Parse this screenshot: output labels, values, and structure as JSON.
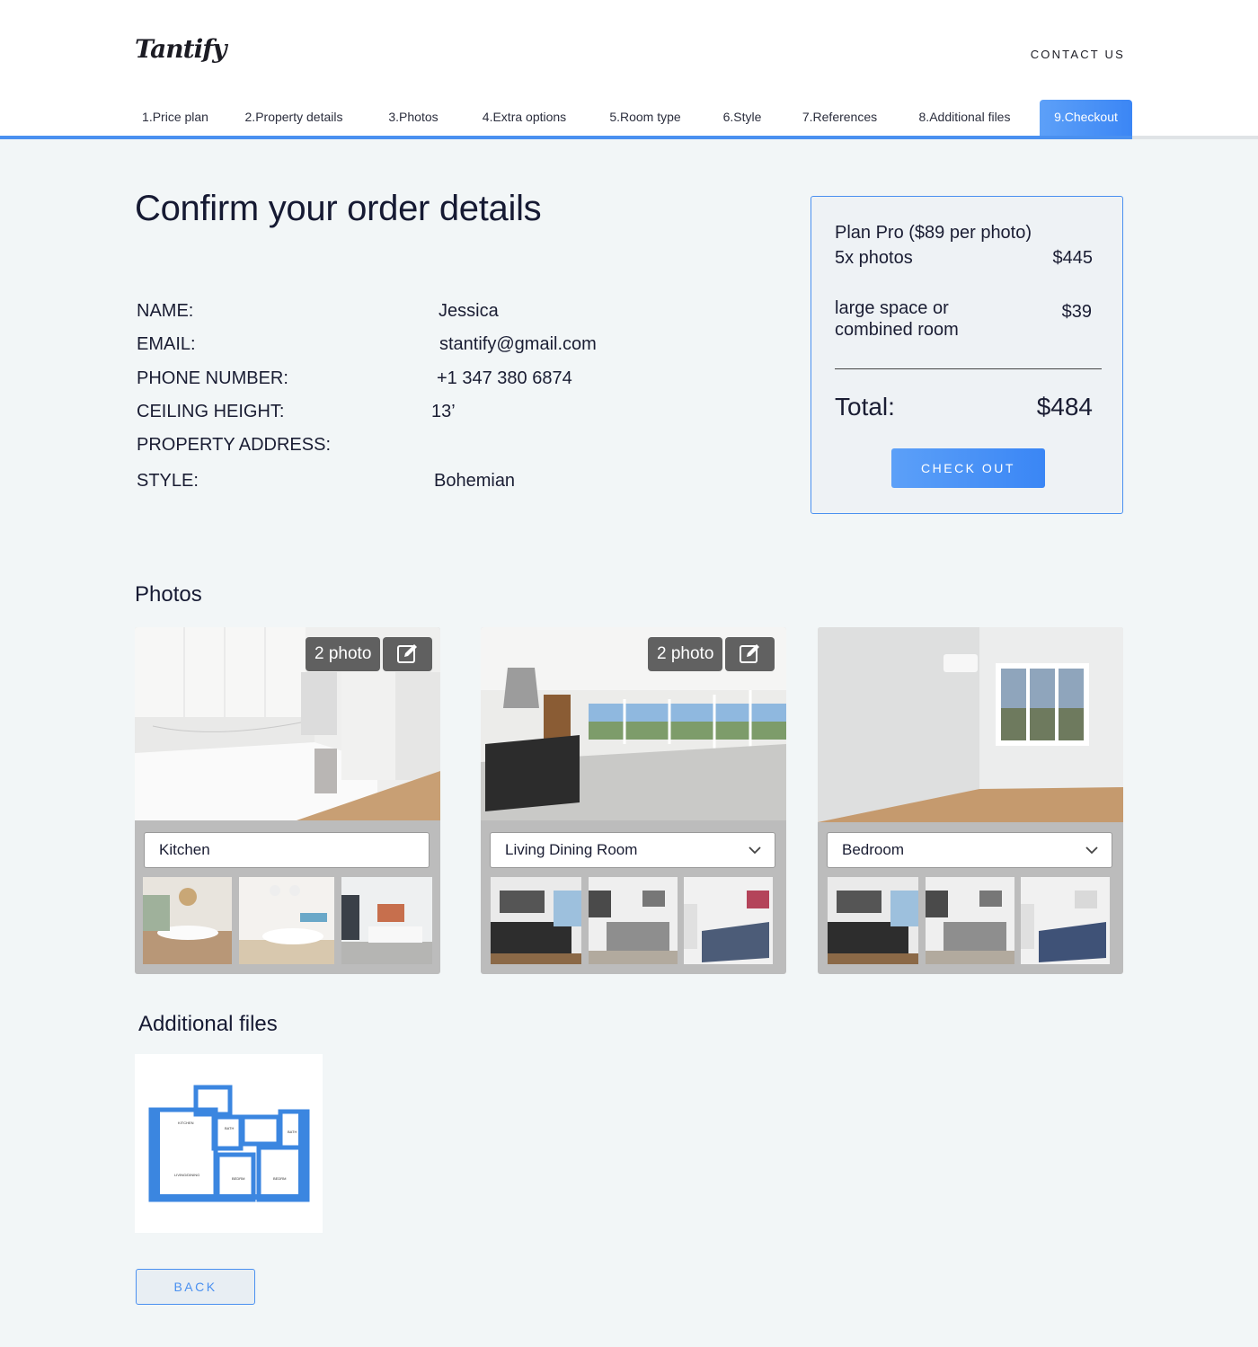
{
  "brand": {
    "logo_text": "Tantify"
  },
  "header": {
    "contact_label": "CONTACT US"
  },
  "steps": [
    {
      "label": "1.Price plan"
    },
    {
      "label": "2.Property details"
    },
    {
      "label": "3.Photos"
    },
    {
      "label": "4.Extra options"
    },
    {
      "label": "5.Room type"
    },
    {
      "label": "6.Style"
    },
    {
      "label": "7.References"
    },
    {
      "label": "8.Additional files"
    },
    {
      "label": "9.Checkout",
      "active": true
    }
  ],
  "page": {
    "title": "Confirm your order details"
  },
  "details": {
    "name_label": "NAME:",
    "name_value": "Jessica",
    "email_label": "EMAIL:",
    "email_value": "stantify@gmail.com",
    "phone_label": "PHONE NUMBER:",
    "phone_value": "+1 347 380 6874",
    "ceiling_label": "CEILING HEIGHT:",
    "ceiling_value": "13’",
    "address_label": "PROPERTY ADDRESS:",
    "address_value": "",
    "style_label": "STYLE:",
    "style_value": "Bohemian"
  },
  "summary": {
    "plan_line": "Plan Pro ($89 per photo)",
    "photos_line": "5x photos",
    "photos_price": "$445",
    "extra_line1": "large space or",
    "extra_line2": "combined room",
    "extra_price": "$39",
    "total_label": "Total:",
    "total_value": "$484",
    "checkout_label": "CHECK OUT"
  },
  "photos_section": {
    "title": "Photos"
  },
  "photo_cards": [
    {
      "badge": "2 photo",
      "room": "Kitchen",
      "has_dropdown": false
    },
    {
      "badge": "2 photo",
      "room": "Living Dining Room",
      "has_dropdown": true
    },
    {
      "badge": "",
      "room": "Bedroom",
      "has_dropdown": true
    }
  ],
  "files_section": {
    "title": "Additional files"
  },
  "footer": {
    "back_label": "BACK"
  },
  "colors": {
    "accent": "#4a90f0",
    "background": "#f2f6f7",
    "text": "#1a1d33",
    "card": "#bcbcbc"
  }
}
